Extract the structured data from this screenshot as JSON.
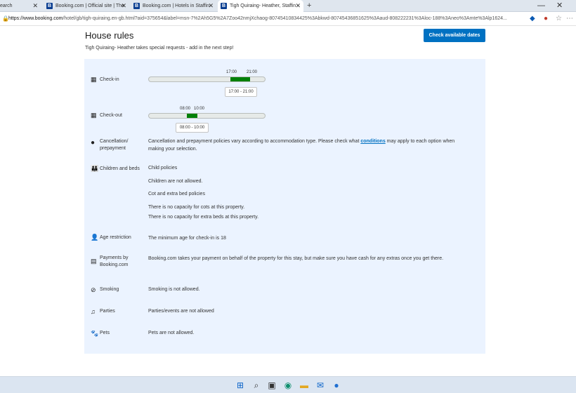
{
  "browser": {
    "tabs": [
      {
        "title": "earch",
        "favicon": ""
      },
      {
        "title": "Booking.com | Official site | The",
        "favicon": "B"
      },
      {
        "title": "Booking.com | Hotels in Staffin",
        "favicon": "B"
      },
      {
        "title": "Tigh Quiraing- Heather, Staffin -",
        "favicon": "B"
      }
    ],
    "new_tab": "+",
    "url_host": "https://www.booking.com",
    "url_path": "/hotel/gb/tigh-quiraing.en-gb.html?aid=375654&label=msn-7%2Ah5G5%2A7Zoo42nmjXchaog-80745410834425%3Abkwd-80745436851625%3Aaud-808222231%3Aloc-188%3Aneo%3Amte%3Alp1624..."
  },
  "page": {
    "title": "House rules",
    "cta": "Check available dates",
    "subtitle": "Tigh Quiraing- Heather takes special requests - add in the next step!"
  },
  "rules": {
    "checkin": {
      "label": "Check-in",
      "tick_start": "17:00",
      "tick_end": "21:00",
      "range": "17:00 - 21:00",
      "start_fraction": 0.7,
      "end_fraction": 0.87
    },
    "checkout": {
      "label": "Check-out",
      "tick_start": "08:00",
      "tick_end": "10:00",
      "range": "08:00 - 10:00",
      "start_fraction": 0.33,
      "end_fraction": 0.42
    },
    "cancellation": {
      "label_line1": "Cancellation/",
      "label_line2": "prepayment",
      "text_before": "Cancellation and prepayment policies vary according to accommodation type. Please check what ",
      "link": "conditions",
      "text_after": " may apply to each option when",
      "text_line2": "making your selection."
    },
    "children": {
      "label": "Children and beds",
      "heading1": "Child policies",
      "line1": "Children are not allowed.",
      "heading2": "Cot and extra bed policies",
      "line2": "There is no capacity for cots at this property.",
      "line3": "There is no capacity for extra beds at this property."
    },
    "age": {
      "label": "Age restriction",
      "text": "The minimum age for check-in is 18"
    },
    "payments": {
      "label_line1": "Payments by",
      "label_line2": "Booking.com",
      "text": "Booking.com takes your payment on behalf of the property for this stay, but make sure you have cash for any extras once you get there."
    },
    "smoking": {
      "label": "Smoking",
      "text": "Smoking is not allowed."
    },
    "parties": {
      "label": "Parties",
      "text": "Parties/events are not allowed"
    },
    "pets": {
      "label": "Pets",
      "text": "Pets are not allowed."
    }
  },
  "colors": {
    "accent": "#0071c2",
    "green": "#008009",
    "panel": "#ebf3ff"
  },
  "icons": [
    "calendar-icon",
    "info-icon",
    "family-icon",
    "person-icon",
    "card-icon",
    "no-smoking-icon",
    "party-icon",
    "paw-icon"
  ]
}
